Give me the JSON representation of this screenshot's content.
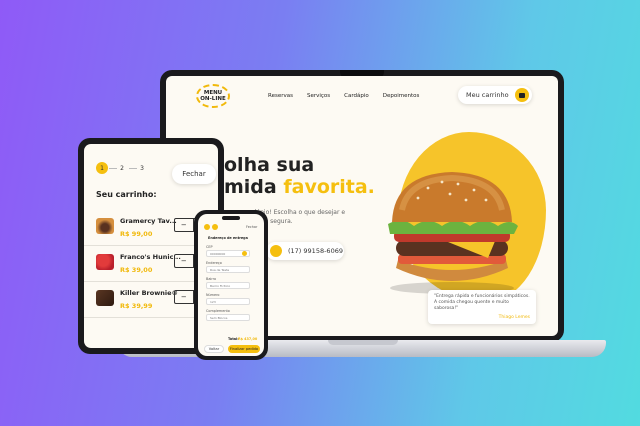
{
  "laptop": {
    "logo_line1": "MENU",
    "logo_line2": "ON-LINE",
    "nav": [
      "Reservas",
      "Serviços",
      "Cardápio",
      "Depoimentos"
    ],
    "cart_button": "Meu carrinho",
    "hero_line1": "olha sua",
    "hero_line2_plain": "mida ",
    "hero_line2_accent": "favorita.",
    "hero_sub": "nosso cardápio! Escolha o que desejar e forma rápida e segura.",
    "phone": "(17) 99158-6069",
    "quote_text": "\"Entrega rápida e funcionários simpáticos. A comida chegou quente e muito saborosa!\"",
    "quote_author": "Thiago Lemes"
  },
  "tablet": {
    "steps": [
      "1",
      "2",
      "3"
    ],
    "close_label": "Fechar",
    "cart_title": "Seu carrinho:",
    "items": [
      {
        "name": "Gramercy Tav...",
        "price": "R$ 99,00",
        "qty": "3"
      },
      {
        "name": "Franco's Hunic...",
        "price": "R$ 39,00",
        "qty": "2"
      },
      {
        "name": "Killer Brownie®",
        "price": "R$ 39,99",
        "qty": "1"
      }
    ],
    "minus": "−"
  },
  "phone": {
    "header_close": "Fechar",
    "title": "Endereço de entrega",
    "cep_label": "CEP",
    "cep_value": "00000000",
    "address_label": "Endereço",
    "address_value": "Rua de Teste",
    "neighborhood_label": "Bairro",
    "neighborhood_value": "Bairro Ficticio",
    "number_label": "Número",
    "number_value": "123",
    "complement_label": "Complemento",
    "complement_value": "Sem Blocos",
    "total_label": "Total:",
    "total_value": "R$ 437,00",
    "back_button": "Voltar",
    "finish_button": "Finalizar pedido"
  },
  "colors": {
    "accent": "#f5bf0f",
    "device": "#1a1a1d",
    "screen": "#fdfaf3"
  }
}
